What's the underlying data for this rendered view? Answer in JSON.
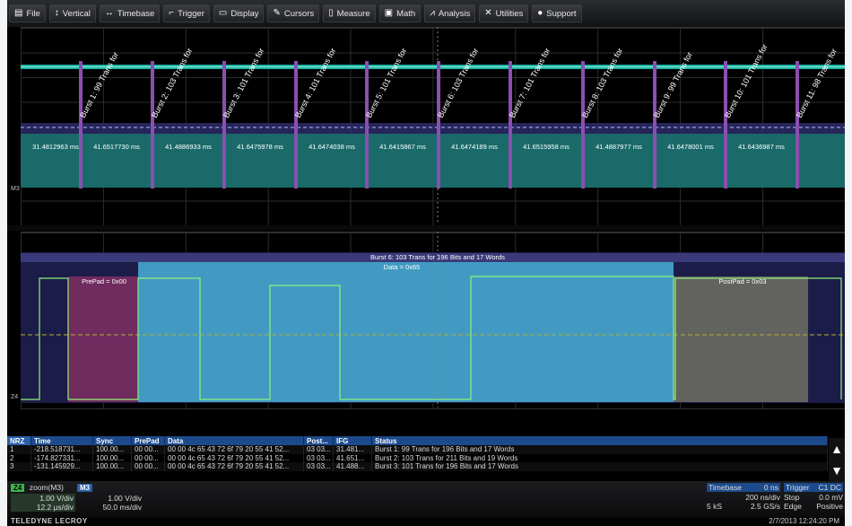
{
  "menu": [
    {
      "label": "File",
      "icon": "file-icon"
    },
    {
      "label": "Vertical",
      "icon": "vertical-arrow-icon"
    },
    {
      "label": "Timebase",
      "icon": "horizontal-arrow-icon"
    },
    {
      "label": "Trigger",
      "icon": "trigger-icon"
    },
    {
      "label": "Display",
      "icon": "display-icon"
    },
    {
      "label": "Cursors",
      "icon": "cursor-icon"
    },
    {
      "label": "Measure",
      "icon": "measure-icon"
    },
    {
      "label": "Math",
      "icon": "math-icon"
    },
    {
      "label": "Analysis",
      "icon": "analysis-icon"
    },
    {
      "label": "Utilities",
      "icon": "utilities-icon"
    },
    {
      "label": "Support",
      "icon": "support-icon"
    }
  ],
  "top_trace": {
    "bursts": [
      "Burst 1: 99 Trans for",
      "Burst 2: 103 Trans for",
      "Burst 3: 101 Trans for",
      "Burst 4: 101 Trans for",
      "Burst 5: 101 Trans for",
      "Burst 6: 103 Trans for",
      "Burst 7: 101 Trans for",
      "Burst 8: 103 Trans for",
      "Burst 9: 99 Trans for",
      "Burst 10: 101 Trans for",
      "Burst 11: 98 Trans for"
    ],
    "ifg": [
      "31.4812963 ms",
      "41.6517730 ms",
      "41.4886933 ms",
      "41.6475978 ms",
      "41.6474038 ms",
      "41.6415867 ms",
      "41.6474189 ms",
      "41.6515958 ms",
      "41.4887977 ms",
      "41.6478001 ms",
      "41.6436987 ms"
    ],
    "marker": "M3"
  },
  "bottom_trace": {
    "title": "Burst 6: 103 Trans for 196 Bits and 17 Words",
    "data_label": "Data = 0x65",
    "prepad": "PrePad = 0x00",
    "postpad": "PostPad = 0x03",
    "marker": "Z4"
  },
  "table": {
    "columns": [
      "NRZ",
      "Time",
      "Sync",
      "PrePad",
      "Data",
      "Post...",
      "IFG",
      "Status"
    ],
    "rows": [
      [
        "1",
        "-218.518731...",
        "100.00...",
        "00 00...",
        "00 00 4c 65 43 72 6f 79 20 55 41 52...",
        "03 03...",
        "31.481...",
        "Burst 1: 99 Trans for 196 Bits and 17 Words"
      ],
      [
        "2",
        "-174.827331...",
        "100.00...",
        "00 00...",
        "00 00 4c 65 43 72 6f 79 20 55 41 52...",
        "03 03...",
        "41.651...",
        "Burst 2: 103 Trans for 211 Bits and 19 Words"
      ],
      [
        "3",
        "-131.145929...",
        "100.00...",
        "00 00...",
        "00 00 4c 65 43 72 6f 79 20 55 41 52...",
        "03 03...",
        "41.488...",
        "Burst 3: 101 Trans for 196 Bits and 17 Words"
      ]
    ]
  },
  "channels": {
    "z4": {
      "badge": "Z4",
      "name": "zoom(M3)",
      "vdiv": "1.00 V/div",
      "tdiv": "12.2 µs/div"
    },
    "m3": {
      "badge": "M3",
      "vdiv": "1.00 V/div",
      "tdiv": "50.0 ms/div"
    }
  },
  "timebase": {
    "label": "Timebase",
    "offset": "0 ns",
    "tdiv": "200 ns/div",
    "samples": "5 kS",
    "rate": "2.5 GS/s"
  },
  "trigger": {
    "label": "Trigger",
    "channel": "C1 DC",
    "mode": "Stop",
    "level": "0.0 mV",
    "type": "Edge",
    "slope": "Positive"
  },
  "status": {
    "brand": "TELEDYNE LECROY",
    "datetime": "2/7/2013 12:24:20 PM"
  },
  "colors": {
    "accent": "#1c4a8c",
    "trace_teal": "#1fa38a",
    "trace_green": "#7ee06a",
    "burst_purple": "#8a4fb0"
  }
}
